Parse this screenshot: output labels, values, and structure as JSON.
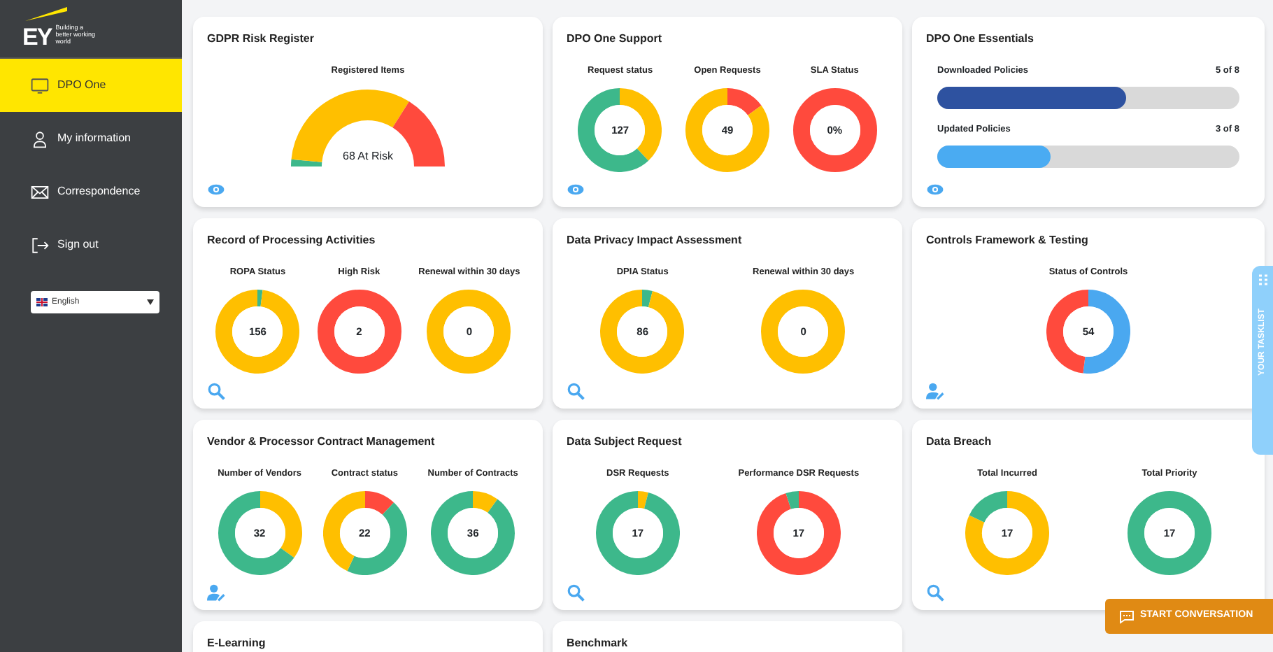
{
  "brand": {
    "logo": "EY",
    "tagline": "Building a better working world"
  },
  "sidebar": {
    "items": [
      {
        "label": "DPO One",
        "selected": true
      },
      {
        "label": "My information",
        "selected": false
      },
      {
        "label": "Correspondence",
        "selected": false
      },
      {
        "label": "Sign out",
        "selected": false
      }
    ],
    "language": {
      "value": "English"
    }
  },
  "cards": [
    {
      "title": "GDPR Risk Register",
      "kind": "gauge",
      "charts": [
        {
          "label": "Registered Items",
          "value": "68 At Risk"
        }
      ]
    },
    {
      "title": "DPO One Support",
      "kind": "donuts",
      "charts": [
        {
          "label": "Request status",
          "value": "127"
        },
        {
          "label": "Open Requests",
          "value": "49"
        },
        {
          "label": "SLA Status",
          "value": "0%"
        }
      ]
    },
    {
      "title": "DPO One Essentials",
      "kind": "progress",
      "bars": [
        {
          "label": "Downloaded Policies",
          "reading": "5 of 8",
          "level": 0.625,
          "color": "#2e52a0"
        },
        {
          "label": "Updated Policies",
          "reading": "3 of 8",
          "level": 0.375,
          "color": "#4aabf2"
        }
      ]
    },
    {
      "title": "Record of Processing Activities",
      "kind": "donuts",
      "charts": [
        {
          "label": "ROPA Status",
          "value": "156"
        },
        {
          "label": "High Risk",
          "value": "2"
        },
        {
          "label": "Renewal within 30 days",
          "value": "0"
        }
      ]
    },
    {
      "title": "Data Privacy Impact Assessment",
      "kind": "donuts",
      "charts": [
        {
          "label": "DPIA Status",
          "value": "86"
        },
        {
          "label": "Renewal within 30 days",
          "value": "0"
        }
      ]
    },
    {
      "title": "Controls Framework & Testing",
      "kind": "donuts",
      "charts": [
        {
          "label": "Status of Controls",
          "value": "54"
        }
      ]
    },
    {
      "title": "Vendor & Processor Contract Management",
      "kind": "donuts",
      "charts": [
        {
          "label": "Number of Vendors",
          "value": "32"
        },
        {
          "label": "Contract status",
          "value": "22"
        },
        {
          "label": "Number of Contracts",
          "value": "36"
        }
      ]
    },
    {
      "title": "Data Subject Request",
      "kind": "donuts",
      "charts": [
        {
          "label": "DSR Requests",
          "value": "17"
        },
        {
          "label": "Performance DSR Requests",
          "value": "17"
        }
      ]
    },
    {
      "title": "Data Breach",
      "kind": "donuts",
      "charts": [
        {
          "label": "Total Incurred",
          "value": "17"
        },
        {
          "label": "Total Priority",
          "value": "17"
        }
      ]
    },
    {
      "title": "E-Learning",
      "kind": "empty"
    },
    {
      "title": "Benchmark",
      "kind": "empty"
    }
  ],
  "tasklist_tab": {
    "label": "YOUR TASKLIST"
  },
  "chat_button": {
    "label": "START CONVERSATION"
  }
}
